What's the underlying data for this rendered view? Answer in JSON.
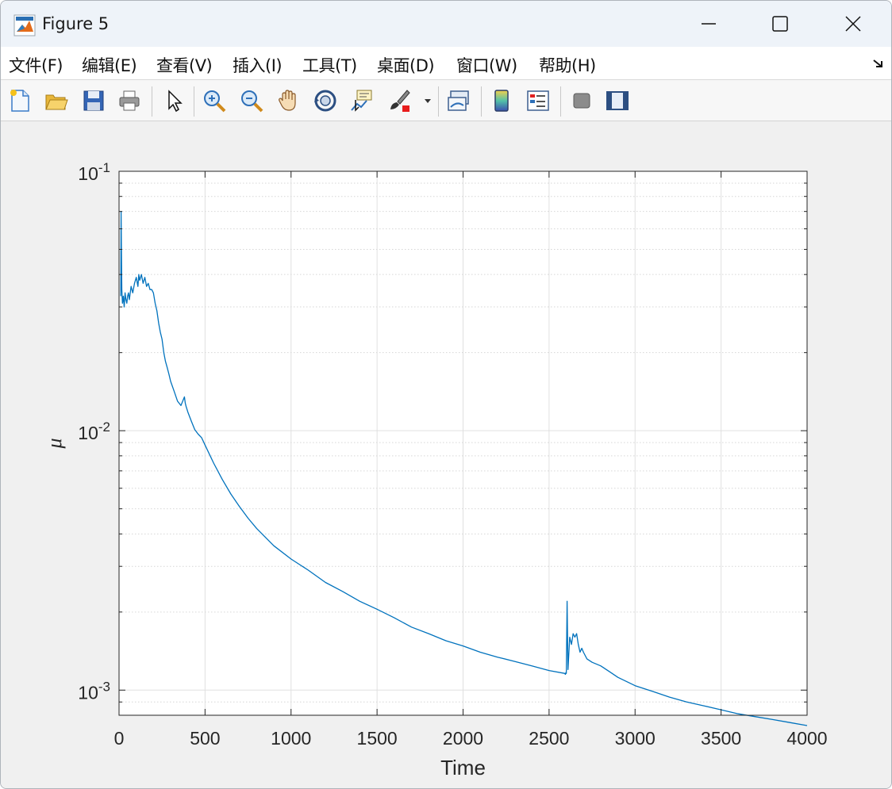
{
  "window": {
    "title": "Figure 5"
  },
  "menu": [
    {
      "label": "文件(F)",
      "x": 10
    },
    {
      "label": "编辑(E)",
      "x": 102
    },
    {
      "label": "查看(V)",
      "x": 196
    },
    {
      "label": "插入(I)",
      "x": 292
    },
    {
      "label": "工具(T)",
      "x": 380
    },
    {
      "label": "桌面(D)",
      "x": 474
    },
    {
      "label": "窗口(W)",
      "x": 574
    },
    {
      "label": "帮助(H)",
      "x": 678
    }
  ],
  "toolbar": {
    "icons": [
      "new-figure-icon",
      "open-file-icon",
      "save-icon",
      "print-icon",
      "pointer-icon",
      "zoom-in-icon",
      "zoom-out-icon",
      "pan-hand-icon",
      "rotate-3d-icon",
      "data-cursor-icon",
      "brush-icon",
      "link-plot-icon",
      "colorbar-icon",
      "legend-icon",
      "hide-plot-tools-icon",
      "show-plot-tools-icon"
    ]
  },
  "chart_data": {
    "type": "line",
    "xlabel": "Time",
    "ylabel": "μ",
    "yscale": "log",
    "xlim": [
      0,
      4000
    ],
    "ylim": [
      0.0008,
      0.1
    ],
    "grid": true,
    "x_ticks": [
      "0",
      "500",
      "1000",
      "1500",
      "2000",
      "2500",
      "3000",
      "3500",
      "4000"
    ],
    "y_ticks": [
      {
        "value": 0.1,
        "base": "10",
        "exp": "-1"
      },
      {
        "value": 0.01,
        "base": "10",
        "exp": "-2"
      },
      {
        "value": 0.001,
        "base": "10",
        "exp": "-3"
      }
    ],
    "series": [
      {
        "color": "#0072bd",
        "x": [
          10,
          12,
          14,
          16,
          20,
          25,
          30,
          35,
          40,
          45,
          50,
          55,
          60,
          70,
          80,
          90,
          100,
          110,
          115,
          120,
          130,
          140,
          150,
          160,
          170,
          180,
          190,
          200,
          210,
          220,
          230,
          240,
          250,
          260,
          270,
          280,
          290,
          300,
          320,
          340,
          360,
          380,
          385,
          390,
          400,
          420,
          440,
          460,
          480,
          500,
          550,
          600,
          650,
          700,
          750,
          800,
          900,
          1000,
          1100,
          1200,
          1300,
          1400,
          1500,
          1600,
          1700,
          1800,
          1900,
          2000,
          2100,
          2200,
          2300,
          2400,
          2500,
          2590,
          2595,
          2598,
          2600,
          2605,
          2610,
          2620,
          2630,
          2640,
          2650,
          2660,
          2670,
          2680,
          2690,
          2700,
          2720,
          2750,
          2800,
          2850,
          2900,
          3000,
          3100,
          3200,
          3300,
          3400,
          3500,
          3600,
          3700,
          3800,
          3900,
          4000
        ],
        "y": [
          0.033,
          0.07,
          0.05,
          0.035,
          0.031,
          0.033,
          0.03,
          0.034,
          0.032,
          0.031,
          0.033,
          0.034,
          0.032,
          0.036,
          0.034,
          0.037,
          0.039,
          0.036,
          0.04,
          0.038,
          0.04,
          0.037,
          0.039,
          0.036,
          0.037,
          0.035,
          0.035,
          0.034,
          0.031,
          0.029,
          0.026,
          0.024,
          0.0225,
          0.02,
          0.0185,
          0.0175,
          0.0165,
          0.0155,
          0.0142,
          0.013,
          0.0125,
          0.0135,
          0.0128,
          0.0124,
          0.0118,
          0.0109,
          0.0101,
          0.0097,
          0.0094,
          0.0088,
          0.0075,
          0.0065,
          0.0057,
          0.0051,
          0.0046,
          0.0042,
          0.0036,
          0.0032,
          0.0029,
          0.0026,
          0.0024,
          0.0022,
          0.00205,
          0.0019,
          0.00175,
          0.00165,
          0.00155,
          0.00148,
          0.0014,
          0.00134,
          0.00129,
          0.00124,
          0.00119,
          0.00116,
          0.00115,
          0.00117,
          0.00116,
          0.0022,
          0.0012,
          0.0016,
          0.0015,
          0.00165,
          0.0016,
          0.00165,
          0.0015,
          0.0014,
          0.00145,
          0.0014,
          0.00132,
          0.00128,
          0.00124,
          0.00118,
          0.00112,
          0.00104,
          0.00099,
          0.00094,
          0.0009,
          0.00087,
          0.00084,
          0.00081,
          0.00079,
          0.00077,
          0.00075,
          0.00073
        ]
      }
    ]
  }
}
